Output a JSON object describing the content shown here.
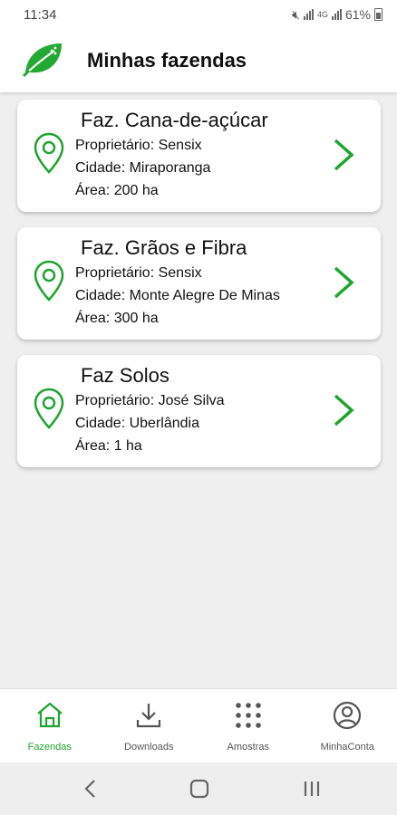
{
  "status_bar": {
    "time": "11:34",
    "battery_percent": "61%"
  },
  "app": {
    "title": "Minhas fazendas",
    "accent": "#1ea52e"
  },
  "farms": [
    {
      "name": "Faz. Cana-de-açúcar",
      "owner": "Proprietário: Sensix",
      "city": "Cidade: Miraporanga",
      "area": "Área: 200 ha"
    },
    {
      "name": "Faz. Grãos e Fibra",
      "owner": "Proprietário: Sensix",
      "city": "Cidade: Monte Alegre De Minas",
      "area": "Área: 300 ha"
    },
    {
      "name": "Faz Solos",
      "owner": "Proprietário: José Silva",
      "city": "Cidade: Uberlândia",
      "area": "Área: 1 ha"
    }
  ],
  "bottom_nav": {
    "items": [
      {
        "label": "Fazendas",
        "icon": "home-icon",
        "active": true
      },
      {
        "label": "Downloads",
        "icon": "download-icon",
        "active": false
      },
      {
        "label": "Amostras",
        "icon": "grid-icon",
        "active": false
      },
      {
        "label": "MinhaConta",
        "icon": "account-icon",
        "active": false
      }
    ]
  },
  "system_nav": [
    "back-icon",
    "home-button-icon",
    "recent-apps-icon"
  ]
}
